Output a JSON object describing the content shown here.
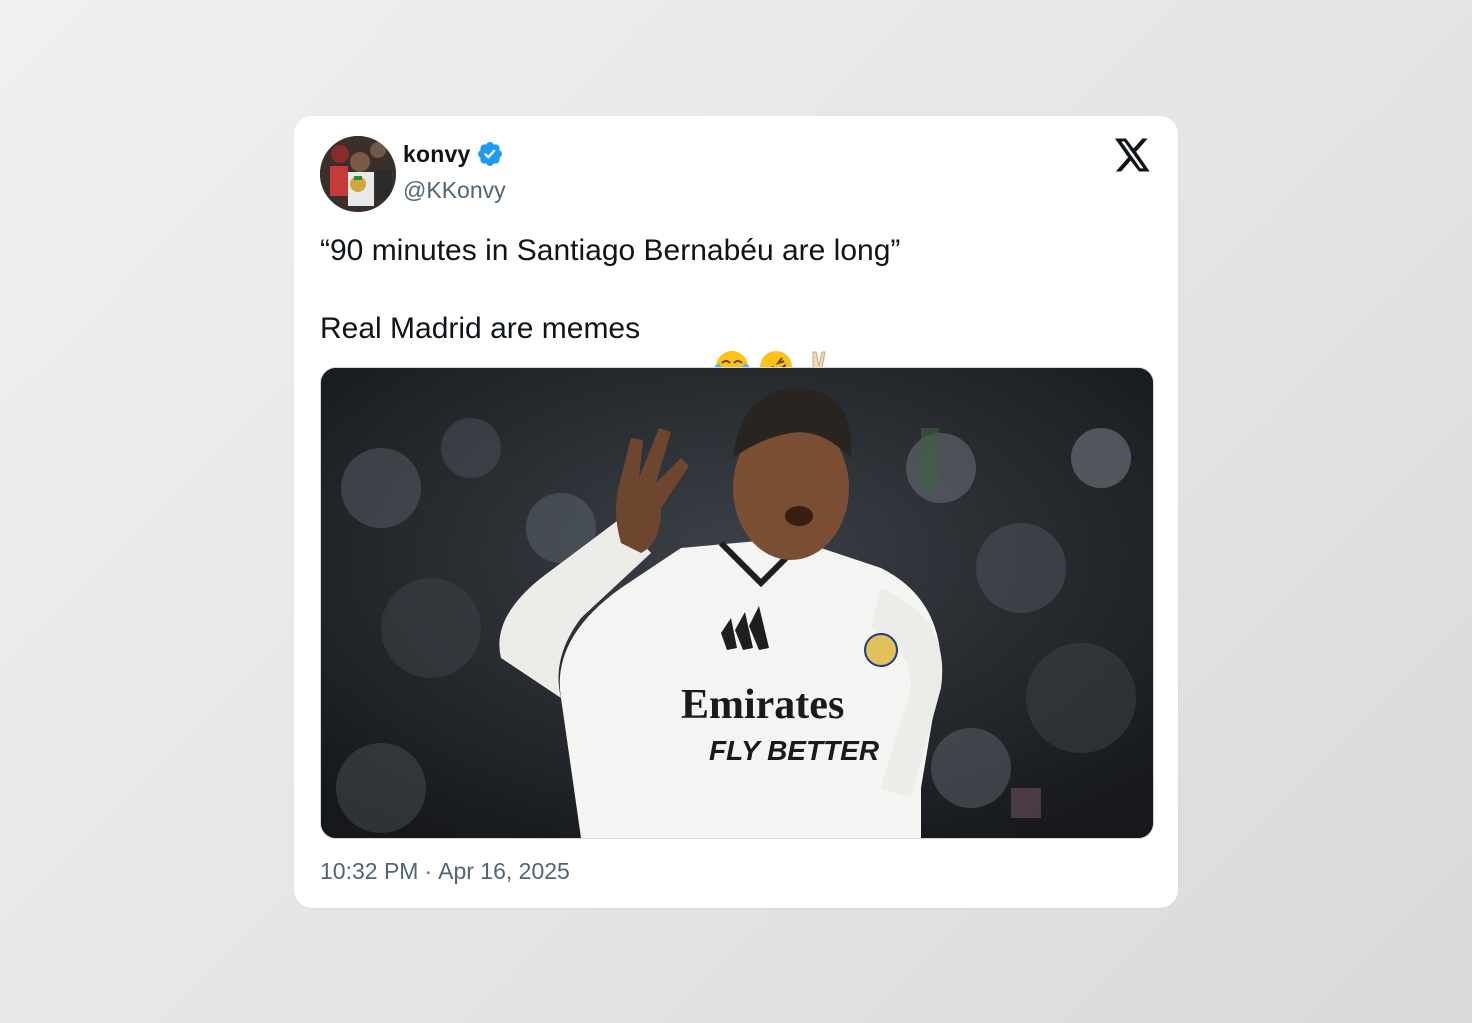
{
  "post": {
    "author": {
      "display_name": "konvy",
      "handle": "@KKonvy",
      "verified": true,
      "avatar_icon": "profile-photo"
    },
    "text_line_1": "“90 minutes in Santiago Bernabéu are long”",
    "text_line_2": "Real Madrid are memes",
    "emojis": [
      "😂",
      "🤣",
      "✌🏼"
    ],
    "media": {
      "type": "photo",
      "jersey_sponsor": "Emirates",
      "jersey_slogan": "FLY BETTER"
    },
    "time": "10:32 PM",
    "separator": "·",
    "date": "Apr 16, 2025"
  },
  "platform_icon": "x-logo-icon",
  "colors": {
    "text": "#0f1419",
    "secondary_text": "#536471",
    "verified_blue": "#1d9bf0",
    "card_bg": "#ffffff"
  }
}
